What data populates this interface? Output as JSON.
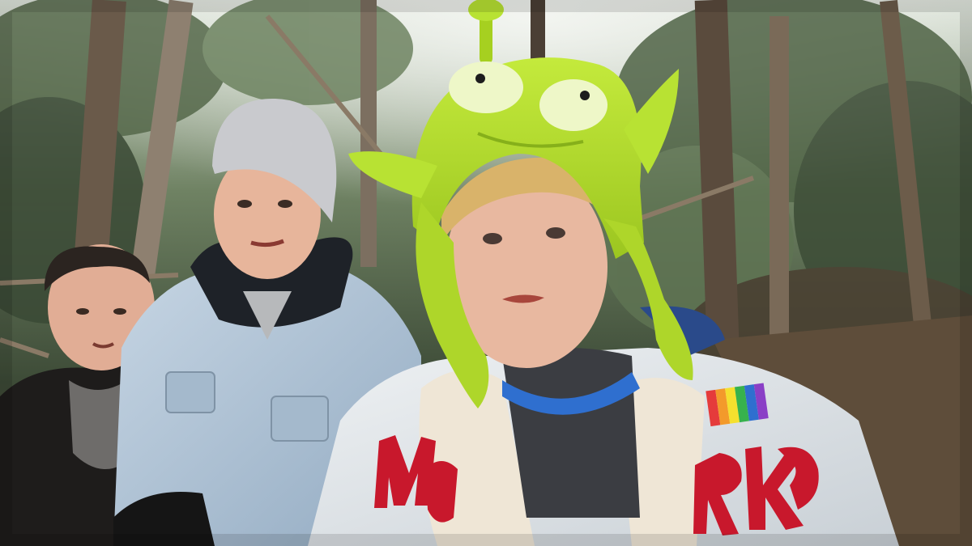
{
  "scene": {
    "description_free": true,
    "palette": {
      "sky": "#e9eee8",
      "forest_dark": "#2f3d2c",
      "forest_mid": "#4e5f45",
      "forest_light": "#8a9a7c",
      "trunk": "#6b5a48",
      "ground": "#6d5a45",
      "alien_green": "#b6e02a",
      "alien_green_dark": "#86b01a",
      "denim": "#b9cbdc",
      "jacket_white": "#e4e7ea",
      "embroidery_red": "#c8182c",
      "beanie": "#c9cace",
      "skin": "#e7b59b",
      "hair_blond": "#d9b36a",
      "hair_dark": "#2b2420",
      "hoodie_blue": "#2f6fcf",
      "black": "#141414"
    },
    "icons": {
      "rainbow_patch": "rainbow-flag-patch-icon"
    }
  }
}
